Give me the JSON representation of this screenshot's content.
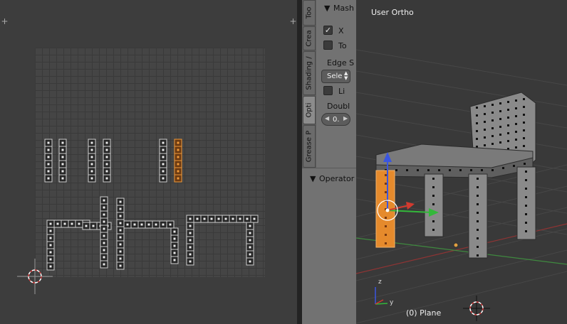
{
  "uv_editor": {
    "area_handle_left": "+",
    "area_handle_right": "+"
  },
  "tool_tabs": [
    {
      "label": "Too",
      "active": false
    },
    {
      "label": "Crea",
      "active": false
    },
    {
      "label": "Shading /",
      "active": false
    },
    {
      "label": "Opti",
      "active": true
    },
    {
      "label": "Grease P",
      "active": false
    }
  ],
  "mesh_panel": {
    "header": "Mash",
    "x_label": "X",
    "x_checked": true,
    "to_label": "To",
    "to_checked": false,
    "edge_label": "Edge S",
    "edge_value": "Sele",
    "li_label": "Li",
    "li_checked": false,
    "doubl_label": "Doubl",
    "doubl_value": "0."
  },
  "operator_panel": {
    "header": "Operator"
  },
  "viewport": {
    "view_name": "User Ortho",
    "object_label": "(0) Plane",
    "axis_z": "z",
    "axis_y": "y"
  },
  "colors": {
    "selected": "#e58a2c",
    "grid": "#454545",
    "axis_x": "#a33a3a",
    "axis_y": "#3f8f3f"
  }
}
